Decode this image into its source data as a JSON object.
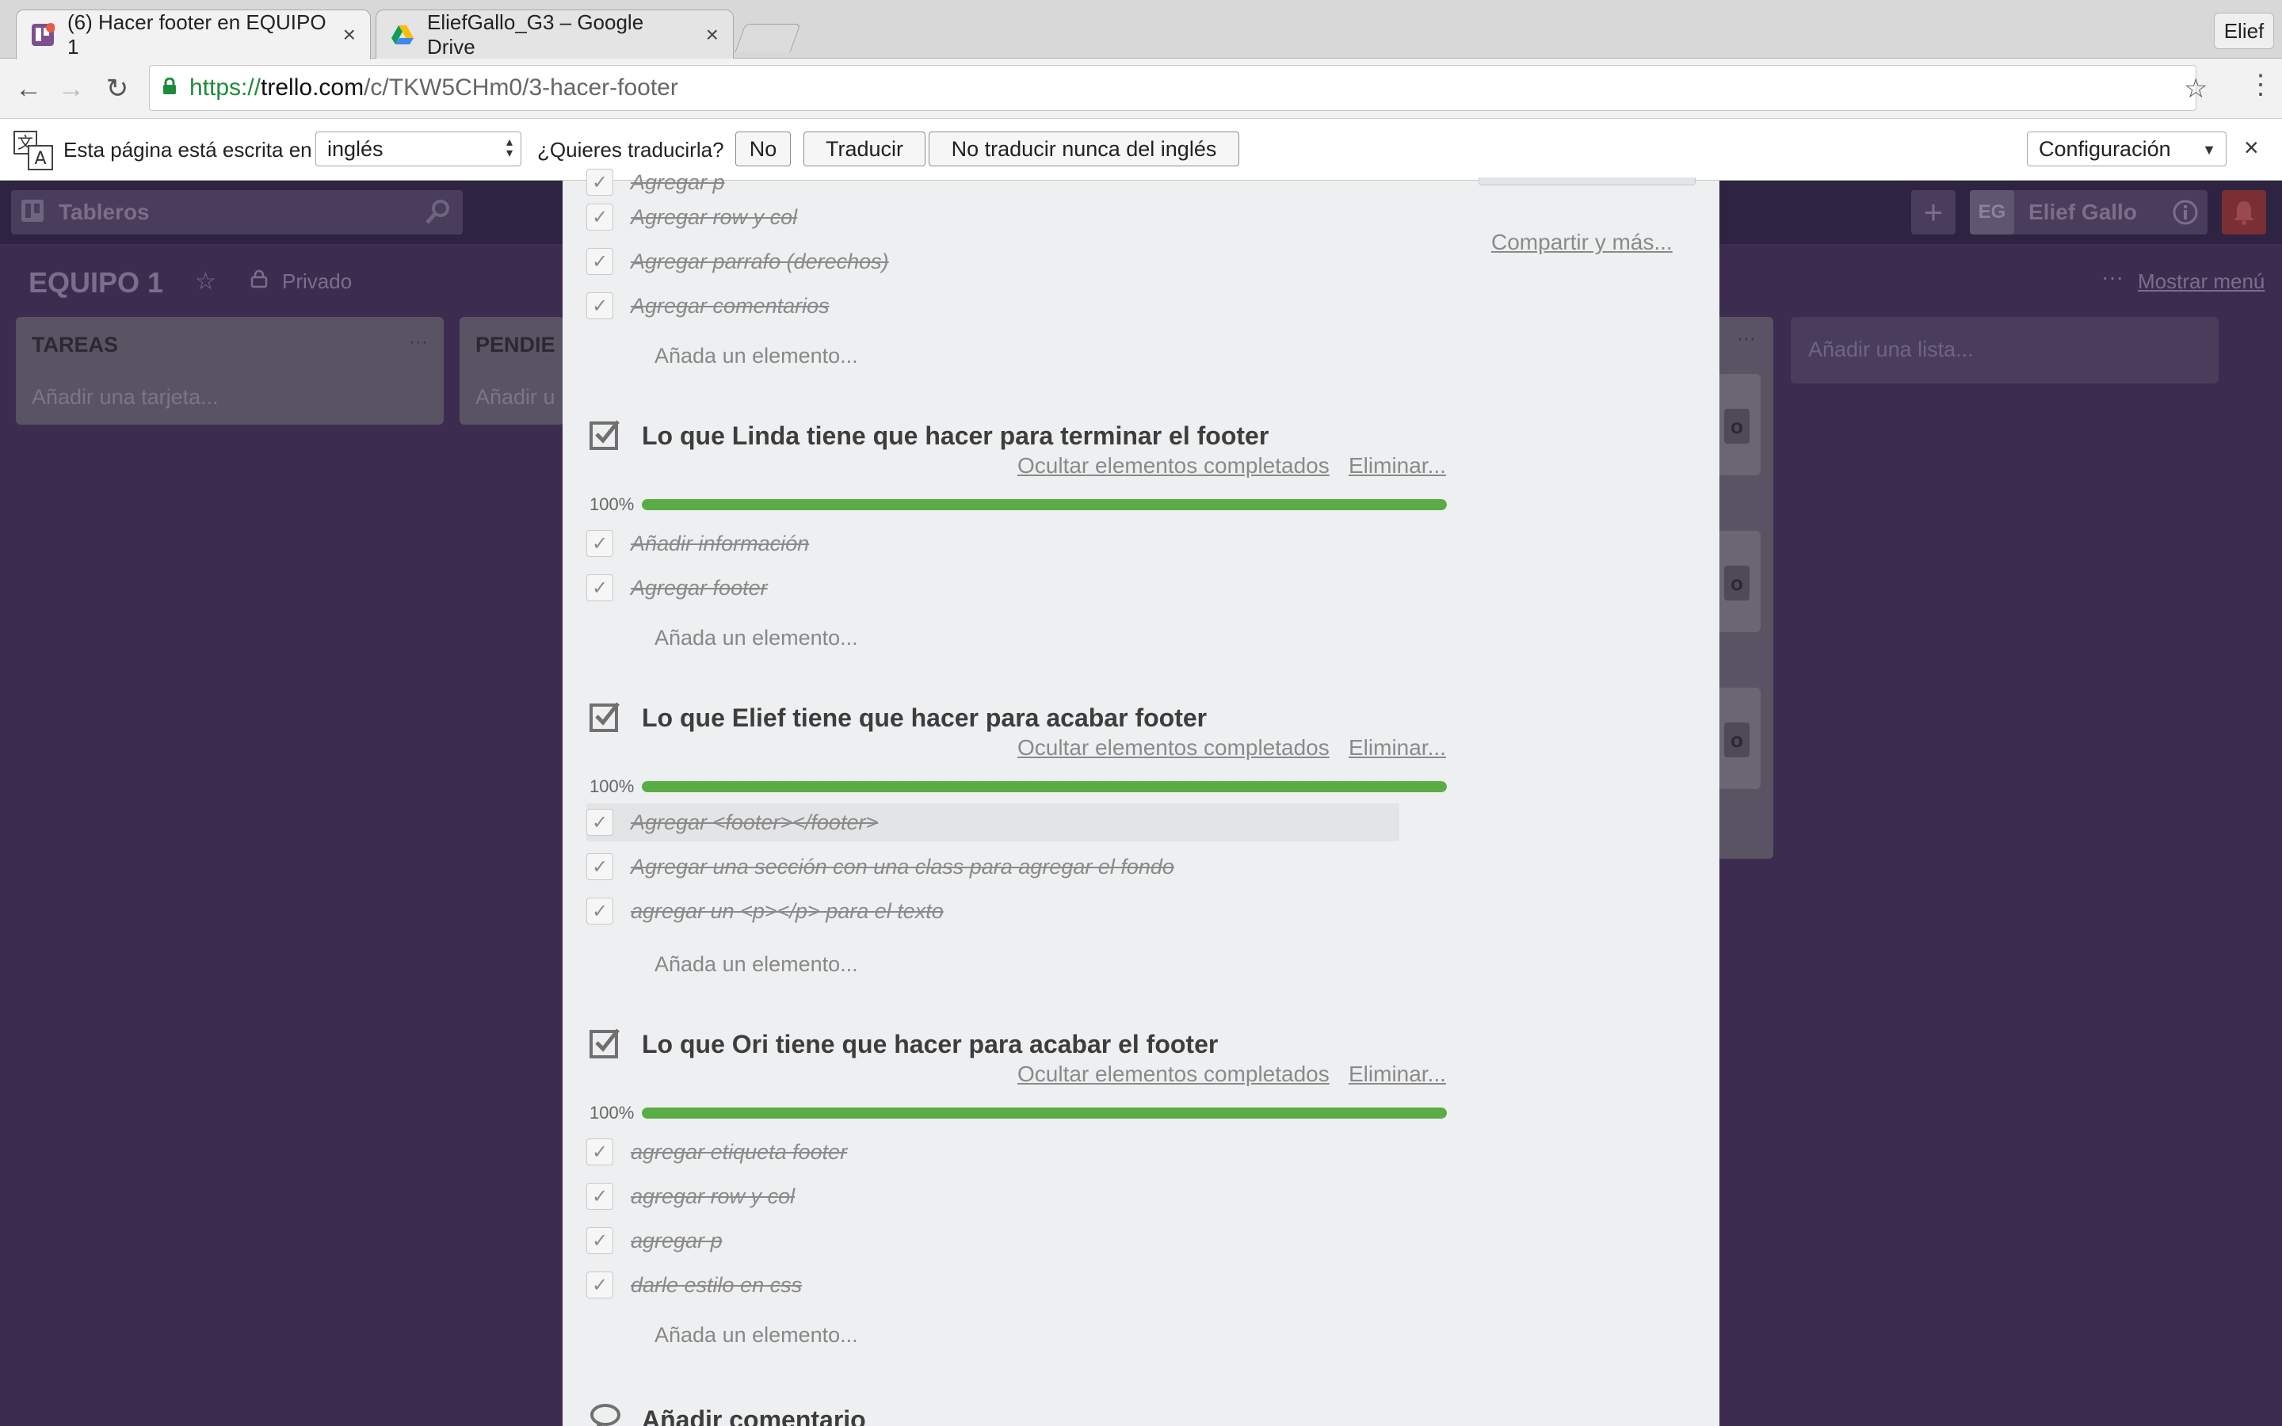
{
  "browser": {
    "tabs": [
      {
        "title": "(6) Hacer footer en EQUIPO 1",
        "active": true
      },
      {
        "title": "EliefGallo_G3 – Google Drive",
        "active": false
      }
    ],
    "profile": "Elief",
    "url": {
      "scheme": "https://",
      "host": "trello.com",
      "path": "/c/TKW5CHm0/3-hacer-footer"
    }
  },
  "translate_bar": {
    "prefix": "Esta página está escrita en",
    "language": "inglés",
    "question": "¿Quieres traducirla?",
    "no": "No",
    "translate": "Traducir",
    "never": "No traducir nunca del inglés",
    "settings": "Configuración",
    "close": "×"
  },
  "board": {
    "boards_button": "Tableros",
    "name": "EQUIPO 1",
    "visibility": "Privado",
    "user_initials": "EG",
    "user_name": "Elief Gallo",
    "show_menu": "Mostrar menú",
    "lists": [
      {
        "name": "TAREAS",
        "add": "Añadir una tarjeta..."
      },
      {
        "name": "PENDIE",
        "add": "Añadir u"
      }
    ],
    "add_list": "Añadir una lista...",
    "card_stub": "o"
  },
  "card": {
    "share": "Compartir y más...",
    "hide_completed": "Ocultar elementos completados",
    "delete": "Eliminar...",
    "add_item": "Añada un elemento...",
    "partial_item": "Agregar p",
    "top_items": [
      "Agregar row y col",
      "Agregar parrafo (derechos)",
      "Agregar comentarios"
    ],
    "checklists": [
      {
        "title": "Lo que Linda tiene que hacer para terminar el footer",
        "progress": "100%",
        "items": [
          "Añadir información",
          "Agregar footer"
        ]
      },
      {
        "title": "Lo que Elief tiene que hacer para acabar footer",
        "progress": "100%",
        "items": [
          "Agregar <footer></footer>",
          "Agregar una sección con una class para agregar el fondo",
          "agregar un <p></p> para el texto"
        ]
      },
      {
        "title": "Lo que Ori tiene que hacer para acabar el footer",
        "progress": "100%",
        "items": [
          "agregar etiqueta footer",
          "agregar row y col",
          "agregar p",
          "darle estilo en css"
        ]
      }
    ],
    "comment_title": "Añadir comentario"
  }
}
